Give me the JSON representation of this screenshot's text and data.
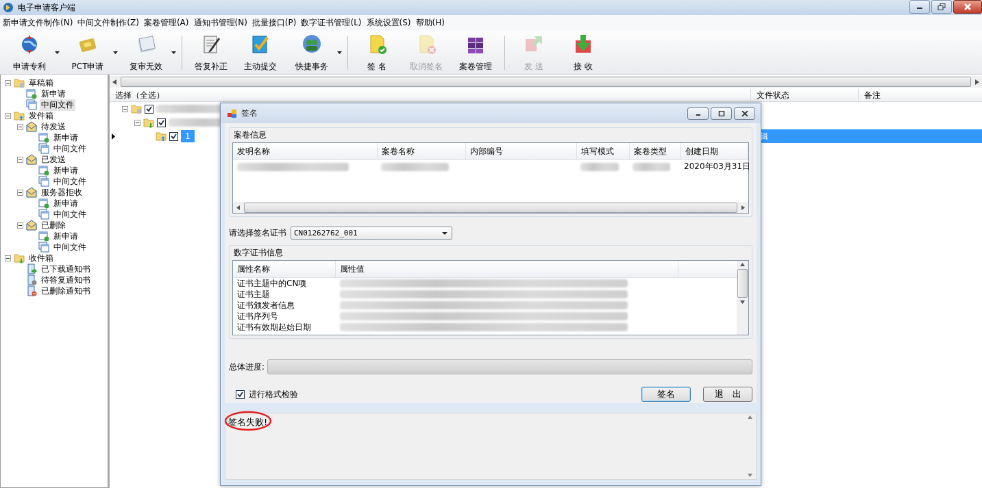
{
  "window": {
    "title": "电子申请客户端"
  },
  "menu": [
    "新申请文件制作(N)",
    "中间文件制作(Z)",
    "案卷管理(A)",
    "通知书管理(N)",
    "批量接口(P)",
    "数字证书管理(L)",
    "系统设置(S)",
    "帮助(H)"
  ],
  "toolbar": [
    {
      "label": "申请专利",
      "kind": "globe",
      "dropdown": true,
      "disabled": false,
      "separator_before": false
    },
    {
      "label": "PCT申请",
      "kind": "pct",
      "dropdown": true,
      "disabled": false,
      "separator_before": false
    },
    {
      "label": "复审无效",
      "kind": "stack",
      "dropdown": true,
      "disabled": false,
      "separator_before": false
    },
    {
      "label": "答复补正",
      "kind": "notepad",
      "dropdown": false,
      "disabled": false,
      "separator_before": true
    },
    {
      "label": "主动提交",
      "kind": "submit",
      "dropdown": false,
      "disabled": false,
      "separator_before": false
    },
    {
      "label": "快捷事务",
      "kind": "people",
      "dropdown": true,
      "disabled": false,
      "separator_before": false
    },
    {
      "label": "签 名",
      "kind": "sign",
      "dropdown": false,
      "disabled": false,
      "separator_before": true
    },
    {
      "label": "取消签名",
      "kind": "cancel",
      "dropdown": false,
      "disabled": true,
      "separator_before": false
    },
    {
      "label": "案卷管理",
      "kind": "books",
      "dropdown": false,
      "disabled": false,
      "separator_before": false
    },
    {
      "label": "发 送",
      "kind": "send",
      "dropdown": false,
      "disabled": true,
      "separator_before": true
    },
    {
      "label": "接 收",
      "kind": "receive",
      "dropdown": false,
      "disabled": false,
      "separator_before": false
    }
  ],
  "tree": [
    {
      "label": "草稿箱",
      "kind": "folder-draft",
      "expanded": true,
      "selected": false,
      "children": [
        {
          "label": "新申请",
          "kind": "doc-new",
          "selected": false
        },
        {
          "label": "中间文件",
          "kind": "doc-mid",
          "selected": true
        }
      ]
    },
    {
      "label": "发件箱",
      "kind": "folder-out",
      "expanded": true,
      "selected": false,
      "children": [
        {
          "label": "待发送",
          "kind": "envelope",
          "expanded": true,
          "selected": false,
          "children": [
            {
              "label": "新申请",
              "kind": "doc-new",
              "selected": false
            },
            {
              "label": "中间文件",
              "kind": "doc-mid",
              "selected": false
            }
          ]
        },
        {
          "label": "已发送",
          "kind": "envelope",
          "expanded": true,
          "selected": false,
          "children": [
            {
              "label": "新申请",
              "kind": "doc-new",
              "selected": false
            },
            {
              "label": "中间文件",
              "kind": "doc-mid",
              "selected": false
            }
          ]
        },
        {
          "label": "服务器拒收",
          "kind": "envelope",
          "expanded": true,
          "selected": false,
          "children": [
            {
              "label": "新申请",
              "kind": "doc-new",
              "selected": false
            },
            {
              "label": "中间文件",
              "kind": "doc-mid",
              "selected": false
            }
          ]
        },
        {
          "label": "已删除",
          "kind": "envelope",
          "expanded": true,
          "selected": false,
          "children": [
            {
              "label": "新申请",
              "kind": "doc-new",
              "selected": false
            },
            {
              "label": "中间文件",
              "kind": "doc-mid",
              "selected": false
            }
          ]
        }
      ]
    },
    {
      "label": "收件箱",
      "kind": "folder-in",
      "expanded": true,
      "selected": false,
      "children": [
        {
          "label": "已下载通知书",
          "kind": "notice-down",
          "selected": false
        },
        {
          "label": "待答复通知书",
          "kind": "notice-wait",
          "selected": false
        },
        {
          "label": "已删除通知书",
          "kind": "notice-del",
          "selected": false
        }
      ]
    }
  ],
  "grid": {
    "columns": [
      {
        "label": "选择（全选）"
      },
      {
        "label": "文件状态"
      },
      {
        "label": "备注"
      }
    ],
    "rows": [
      {
        "kind": "folder-draft",
        "checked": true,
        "redacted": true,
        "expanded": true,
        "selected": false,
        "children": [
          {
            "kind": "folder-in",
            "checked": true,
            "redacted": true,
            "expanded": true,
            "selected": false,
            "children": [
              {
                "kind": "folder-out",
                "checked": true,
                "text": "1",
                "status": "辑",
                "selected": true
              }
            ]
          }
        ]
      }
    ]
  },
  "dialog": {
    "title": "签名",
    "case_group": {
      "title": "案卷信息",
      "columns": [
        "发明名称",
        "案卷名称",
        "内部编号",
        "填写模式",
        "案卷类型",
        "创建日期"
      ],
      "rows": [
        {
          "cells": [
            {
              "redacted": true
            },
            {
              "redacted": true
            },
            {},
            {
              "redacted": true
            },
            {
              "redacted": true
            },
            {
              "text": "2020年03月31日"
            }
          ]
        }
      ]
    },
    "cert_select": {
      "label": "请选择签名证书",
      "value": "CN01262762_001"
    },
    "cert_group": {
      "title": "数字证书信息",
      "columns": [
        "属性名称",
        "属性值"
      ],
      "rows": [
        {
          "name": "证书主题中的CN项",
          "redacted": true
        },
        {
          "name": "证书主题",
          "redacted": true
        },
        {
          "name": "证书颁发者信息",
          "redacted": true
        },
        {
          "name": "证书序列号",
          "redacted": true
        },
        {
          "name": "证书有效期起始日期",
          "redacted": true
        }
      ]
    },
    "progress": {
      "label": "总体进度:",
      "level": 0
    },
    "format_check": {
      "label": "进行格式检验",
      "checked": true
    },
    "buttons": [
      {
        "label": "签名",
        "default": true
      },
      {
        "label": "退　出",
        "default": false
      }
    ],
    "log": {
      "text": "签名失败!",
      "circled": true
    }
  }
}
